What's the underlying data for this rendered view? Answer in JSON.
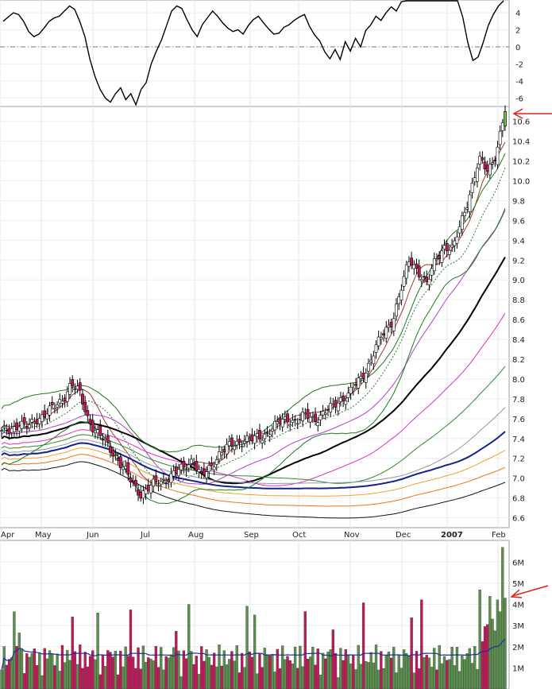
{
  "chart_data": [
    {
      "type": "line",
      "panel": "oscillator",
      "y_ticks": [
        4,
        2,
        0,
        -2,
        -4,
        -6
      ],
      "tick_labels": [
        "4",
        "2",
        "0",
        "-2",
        "-4",
        "-6"
      ],
      "ylim": [
        -7,
        5.5
      ],
      "zero_line": true,
      "series": [
        {
          "values": [
            3,
            3.5,
            4,
            3.8,
            3,
            1.8,
            1.2,
            1.5,
            2.2,
            3,
            3.4,
            3.6,
            4.2,
            4.8,
            4.4,
            3,
            1.2,
            -1.5,
            -3.5,
            -5,
            -6,
            -6.5,
            -5.5,
            -4.8,
            -6.2,
            -5.5,
            -6.8,
            -5,
            -4.2,
            -2,
            -0.5,
            0.8,
            2.5,
            4.2,
            4.8,
            4.5,
            3.2,
            2,
            1.2,
            2.6,
            3.4,
            4.2,
            3.6,
            2.8,
            2.2,
            1.8,
            2,
            1.5,
            2.5,
            3.2,
            3.6,
            2.8,
            2.1,
            1.5,
            1.6,
            2.3,
            2.6,
            3.1,
            3.5,
            3.8,
            2.4,
            1.4,
            0.7,
            -0.6,
            -1.4,
            -0.3,
            -1.5,
            0.6,
            -0.5,
            1,
            0,
            1.9,
            2.6,
            3.6,
            3.1,
            4,
            4.7,
            4.2,
            5.3,
            5.8,
            6,
            5.5,
            5.5,
            5.5,
            5.5,
            5.5,
            5.5,
            5.5,
            6,
            5.5,
            3.5,
            0.5,
            -1.6,
            -1.2,
            0.5,
            2.5,
            3.8,
            4.8,
            5.5
          ]
        }
      ]
    },
    {
      "type": "candlestick",
      "panel": "price",
      "x_ticks": [
        "Apr",
        "May",
        "Jun",
        "Jul",
        "Aug",
        "Sep",
        "Oct",
        "Nov",
        "Dec",
        "2007",
        "Feb"
      ],
      "y_ticks": [
        10.6,
        10.4,
        10.2,
        10.0,
        9.8,
        9.6,
        9.4,
        9.2,
        9.0,
        8.8,
        8.6,
        8.4,
        8.2,
        8.0,
        7.8,
        7.6,
        7.4,
        7.2,
        7.0,
        6.8,
        6.6
      ],
      "tick_labels": [
        "10.6",
        "10.4",
        "10.2",
        "10.0",
        "9.8",
        "9.6",
        "9.4",
        "9.2",
        "9.0",
        "8.8",
        "8.6",
        "8.4",
        "8.2",
        "8.0",
        "7.8",
        "7.6",
        "7.4",
        "7.2",
        "7.0",
        "6.8",
        "6.6"
      ],
      "ylim": [
        6.5,
        10.75
      ],
      "grid": true,
      "close": [
        7.45,
        7.5,
        7.55,
        7.5,
        7.6,
        7.65,
        7.7,
        7.8,
        7.95,
        7.85,
        7.6,
        7.45,
        7.35,
        7.25,
        7.1,
        6.95,
        6.85,
        6.9,
        6.95,
        7.0,
        7.05,
        7.1,
        7.2,
        7.0,
        7.1,
        7.25,
        7.3,
        7.35,
        7.4,
        7.38,
        7.42,
        7.5,
        7.55,
        7.6,
        7.58,
        7.62,
        7.6,
        7.65,
        7.7,
        7.8,
        7.85,
        7.95,
        8.1,
        8.3,
        8.45,
        8.6,
        8.9,
        9.2,
        9.1,
        8.95,
        9.2,
        9.35,
        9.3,
        9.6,
        9.9,
        10.2,
        10.1,
        10.3,
        10.7
      ],
      "volume_ticks": [
        6,
        5,
        4,
        3,
        2,
        1
      ],
      "volume_tick_labels": [
        "6M",
        "5M",
        "4M",
        "3M",
        "2M",
        "1M"
      ]
    }
  ],
  "colors": {
    "up": "#5a8f4e",
    "down": "#c0195a",
    "arrow": "#e0201b",
    "current": "#79c24a"
  }
}
